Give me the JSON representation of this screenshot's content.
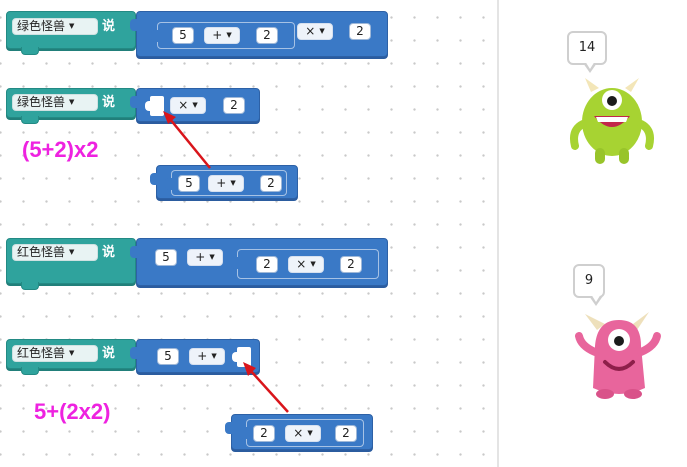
{
  "colors": {
    "say_block": "#2fa39d",
    "operator_block": "#3a79c6",
    "annotation": "#ee22e0",
    "arrow": "#d9151b"
  },
  "icons": {
    "arrow": "red-arrow-icon",
    "green_monster": "green-monster-icon",
    "pink_monster": "pink-monster-icon",
    "dropdown": "triangle-down-icon"
  },
  "blocks": [
    {
      "sprite": "绿色怪兽",
      "verb": "说",
      "a": "5",
      "op1": "+",
      "b": "2",
      "op2": "×",
      "c": "2"
    },
    {
      "sprite": "绿色怪兽",
      "verb": "说",
      "op": "×",
      "value": "2",
      "detached": {
        "a": "5",
        "op": "+",
        "b": "2"
      }
    },
    {
      "sprite": "红色怪兽",
      "verb": "说",
      "a": "5",
      "op1": "+",
      "b": "2",
      "op2": "×",
      "c": "2"
    },
    {
      "sprite": "红色怪兽",
      "verb": "说",
      "a": "5",
      "op": "+",
      "detached": {
        "a": "2",
        "op": "×",
        "b": "2"
      }
    }
  ],
  "annotations": {
    "note1": "(5+2)x2",
    "note2": "5+(2x2)"
  },
  "stage": {
    "green_bubble": "14",
    "pink_bubble": "9"
  }
}
